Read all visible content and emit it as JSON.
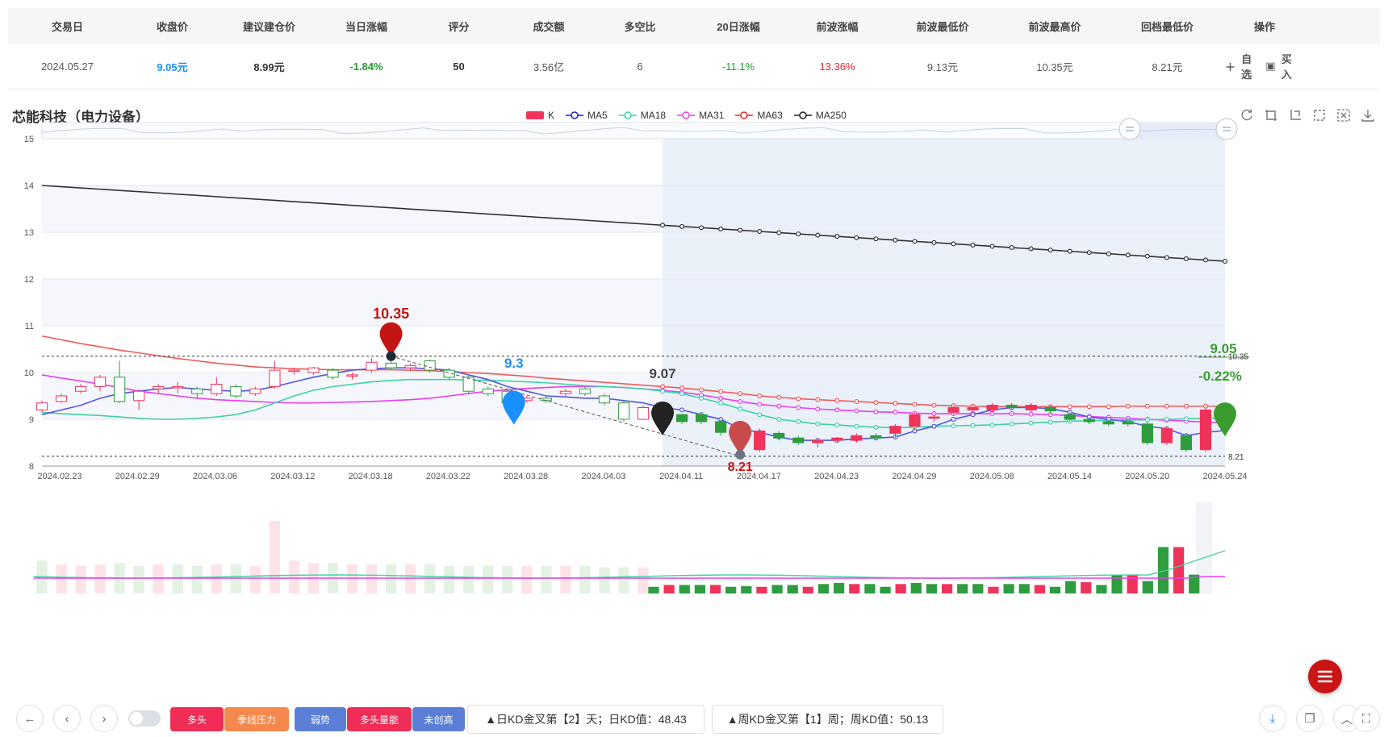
{
  "table": {
    "headers": [
      "交易日",
      "收盘价",
      "建议建仓价",
      "当日涨幅",
      "评分",
      "成交额",
      "多空比",
      "20日涨幅",
      "前波涨幅",
      "前波最低价",
      "前波最高价",
      "回档最低价",
      "操作"
    ],
    "row": [
      "2024.05.27",
      "9.05元",
      "8.99元",
      "-1.84%",
      "50",
      "3.56亿",
      "6",
      "-11.1%",
      "13.36%",
      "9.13元",
      "10.35元",
      "8.21元"
    ],
    "actions": {
      "watch": "自选",
      "buy": "买入"
    }
  },
  "chart_title": "芯能科技（电力设备）",
  "legend": [
    {
      "name": "K",
      "color": "#f0335a"
    },
    {
      "name": "MA5",
      "color": "#1f1fcf"
    },
    {
      "name": "MA18",
      "color": "#3fd1a4"
    },
    {
      "name": "MA31",
      "color": "#e83ff0"
    },
    {
      "name": "MA63",
      "color": "#e8262e"
    },
    {
      "name": "MA250",
      "color": "#222222"
    }
  ],
  "chart_data": {
    "type": "candlestick",
    "ylim": [
      8,
      15
    ],
    "y_ticks": [
      "8",
      "9",
      "10",
      "11",
      "12",
      "13",
      "14",
      "15"
    ],
    "x_tick_labels": [
      "2024.02.23",
      "2024.02.29",
      "2024.03.06",
      "2024.03.12",
      "2024.03.18",
      "2024.03.22",
      "2024.03.28",
      "2024.04.03",
      "2024.04.11",
      "2024.04.17",
      "2024.04.23",
      "2024.04.29",
      "2024.05.08",
      "2024.05.14",
      "2024.05.20",
      "2024.05.24"
    ],
    "candles": [
      [
        9.2,
        9.35,
        9.15,
        9.4
      ],
      [
        9.38,
        9.5,
        9.35,
        9.55
      ],
      [
        9.6,
        9.7,
        9.55,
        9.75
      ],
      [
        9.7,
        9.9,
        9.6,
        9.95
      ],
      [
        9.9,
        9.38,
        9.35,
        10.25
      ],
      [
        9.4,
        9.6,
        9.2,
        9.65
      ],
      [
        9.65,
        9.7,
        9.55,
        9.75
      ],
      [
        9.7,
        9.7,
        9.55,
        9.8
      ],
      [
        9.65,
        9.55,
        9.45,
        9.7
      ],
      [
        9.55,
        9.75,
        9.5,
        9.9
      ],
      [
        9.7,
        9.5,
        9.45,
        9.75
      ],
      [
        9.55,
        9.65,
        9.5,
        9.7
      ],
      [
        9.7,
        10.05,
        9.65,
        10.25
      ],
      [
        10.05,
        10.05,
        9.95,
        10.1
      ],
      [
        10.0,
        10.1,
        9.95,
        10.12
      ],
      [
        10.05,
        9.9,
        9.85,
        10.1
      ],
      [
        9.95,
        9.95,
        9.85,
        10.0
      ],
      [
        10.05,
        10.22,
        10.0,
        10.3
      ],
      [
        10.2,
        10.1,
        10.05,
        10.35
      ],
      [
        10.1,
        10.15,
        10.05,
        10.2
      ],
      [
        10.25,
        10.05,
        10.0,
        10.28
      ],
      [
        10.05,
        9.9,
        9.85,
        10.1
      ],
      [
        9.9,
        9.6,
        9.55,
        9.95
      ],
      [
        9.65,
        9.55,
        9.5,
        9.7
      ],
      [
        9.6,
        9.35,
        9.3,
        9.65
      ],
      [
        9.4,
        9.45,
        9.35,
        9.5
      ],
      [
        9.45,
        9.4,
        9.35,
        9.5
      ],
      [
        9.55,
        9.6,
        9.5,
        9.65
      ],
      [
        9.65,
        9.55,
        9.5,
        9.7
      ],
      [
        9.5,
        9.35,
        9.3,
        9.55
      ],
      [
        9.35,
        9.0,
        8.95,
        9.4
      ],
      [
        9.0,
        9.25,
        8.98,
        9.3
      ],
      [
        9.25,
        9.07,
        9.0,
        9.3
      ],
      [
        9.1,
        8.95,
        8.9,
        9.12
      ],
      [
        9.1,
        8.95,
        8.9,
        9.15
      ],
      [
        8.95,
        8.72,
        8.65,
        9.0
      ],
      [
        8.75,
        8.5,
        8.21,
        8.8
      ],
      [
        8.35,
        8.75,
        8.3,
        8.8
      ],
      [
        8.7,
        8.6,
        8.55,
        8.75
      ],
      [
        8.6,
        8.5,
        8.45,
        8.65
      ],
      [
        8.5,
        8.55,
        8.4,
        8.6
      ],
      [
        8.55,
        8.6,
        8.5,
        8.62
      ],
      [
        8.55,
        8.65,
        8.5,
        8.7
      ],
      [
        8.65,
        8.6,
        8.55,
        8.7
      ],
      [
        8.7,
        8.85,
        8.6,
        8.9
      ],
      [
        8.85,
        9.1,
        8.8,
        9.15
      ],
      [
        9.05,
        9.05,
        8.95,
        9.1
      ],
      [
        9.15,
        9.25,
        9.1,
        9.3
      ],
      [
        9.2,
        9.25,
        9.15,
        9.3
      ],
      [
        9.2,
        9.3,
        9.15,
        9.35
      ],
      [
        9.3,
        9.25,
        9.2,
        9.35
      ],
      [
        9.2,
        9.3,
        9.15,
        9.35
      ],
      [
        9.25,
        9.18,
        9.1,
        9.3
      ],
      [
        9.1,
        9.0,
        8.95,
        9.15
      ],
      [
        9.0,
        8.95,
        8.9,
        9.05
      ],
      [
        8.95,
        8.9,
        8.85,
        9.0
      ],
      [
        8.95,
        8.9,
        8.85,
        9.0
      ],
      [
        8.9,
        8.5,
        8.45,
        8.95
      ],
      [
        8.5,
        8.8,
        8.45,
        8.85
      ],
      [
        8.65,
        8.35,
        8.3,
        8.7
      ],
      [
        8.35,
        9.2,
        8.3,
        9.25
      ],
      [
        9.2,
        9.05,
        9.0,
        9.3
      ]
    ],
    "ma5": [
      9.1,
      9.2,
      9.3,
      9.45,
      9.55,
      9.6,
      9.65,
      9.68,
      9.65,
      9.62,
      9.6,
      9.62,
      9.7,
      9.8,
      9.9,
      9.98,
      10.05,
      10.08,
      10.1,
      10.1,
      10.08,
      10.05,
      9.95,
      9.85,
      9.7,
      9.6,
      9.5,
      9.48,
      9.45,
      9.45,
      9.4,
      9.35,
      9.25,
      9.2,
      9.1,
      9.0,
      8.8,
      8.72,
      8.62,
      8.55,
      8.55,
      8.55,
      8.58,
      8.6,
      8.62,
      8.75,
      8.85,
      9.0,
      9.1,
      9.2,
      9.25,
      9.25,
      9.23,
      9.15,
      9.05,
      9.0,
      8.95,
      8.85,
      8.8,
      8.65,
      8.72,
      8.76
    ],
    "ma18": [
      9.15,
      9.12,
      9.1,
      9.08,
      9.05,
      9.02,
      9.0,
      9.0,
      9.02,
      9.05,
      9.1,
      9.2,
      9.35,
      9.5,
      9.62,
      9.7,
      9.75,
      9.8,
      9.83,
      9.85,
      9.85,
      9.85,
      9.84,
      9.83,
      9.82,
      9.8,
      9.78,
      9.75,
      9.72,
      9.7,
      9.68,
      9.65,
      9.6,
      9.55,
      9.45,
      9.35,
      9.22,
      9.1,
      9.0,
      8.95,
      8.9,
      8.88,
      8.85,
      8.83,
      8.82,
      8.83,
      8.85,
      8.86,
      8.87,
      8.88,
      8.9,
      8.92,
      8.94,
      8.96,
      8.97,
      8.98,
      8.98,
      8.99,
      9.0,
      9.01,
      9.02,
      9.03
    ],
    "ma31": [
      9.95,
      9.88,
      9.82,
      9.75,
      9.68,
      9.6,
      9.55,
      9.5,
      9.45,
      9.42,
      9.4,
      9.38,
      9.36,
      9.35,
      9.35,
      9.36,
      9.37,
      9.38,
      9.4,
      9.42,
      9.45,
      9.5,
      9.55,
      9.6,
      9.63,
      9.66,
      9.68,
      9.7,
      9.7,
      9.7,
      9.68,
      9.65,
      9.62,
      9.58,
      9.52,
      9.45,
      9.38,
      9.32,
      9.28,
      9.25,
      9.22,
      9.2,
      9.18,
      9.16,
      9.15,
      9.13,
      9.12,
      9.12,
      9.12,
      9.12,
      9.12,
      9.11,
      9.1,
      9.08,
      9.06,
      9.04,
      9.02,
      9.0,
      8.98,
      8.96,
      8.94,
      8.92
    ],
    "ma63": [
      10.78,
      10.7,
      10.62,
      10.55,
      10.48,
      10.42,
      10.36,
      10.3,
      10.25,
      10.2,
      10.16,
      10.12,
      10.1,
      10.08,
      10.07,
      10.06,
      10.06,
      10.06,
      10.06,
      10.05,
      10.04,
      10.02,
      10.0,
      9.98,
      9.95,
      9.92,
      9.88,
      9.85,
      9.82,
      9.79,
      9.76,
      9.73,
      9.7,
      9.67,
      9.63,
      9.59,
      9.55,
      9.5,
      9.47,
      9.44,
      9.42,
      9.4,
      9.38,
      9.36,
      9.34,
      9.32,
      9.3,
      9.29,
      9.28,
      9.27,
      9.27,
      9.27,
      9.27,
      9.27,
      9.27,
      9.27,
      9.28,
      9.28,
      9.28,
      9.28,
      9.28,
      9.28
    ],
    "ma250_start": 14.0,
    "ma250_end": 12.38,
    "volume_up": [
      false,
      true,
      true,
      true,
      false,
      false,
      true,
      false,
      false,
      true,
      false,
      true,
      true,
      true,
      true,
      false,
      true,
      true,
      false,
      true,
      false,
      false,
      false,
      false,
      false,
      true,
      false,
      true,
      false,
      false,
      false,
      true,
      false,
      false,
      false,
      false,
      false,
      true,
      false,
      false,
      true,
      true,
      true,
      false,
      true,
      true,
      true,
      true,
      false,
      true,
      true,
      false,
      false,
      false,
      false,
      false,
      false,
      false,
      true,
      false,
      true,
      false
    ],
    "volume": [
      0.45,
      0.4,
      0.38,
      0.4,
      0.42,
      0.38,
      0.4,
      0.4,
      0.38,
      0.4,
      0.4,
      0.38,
      1.0,
      0.45,
      0.42,
      0.42,
      0.4,
      0.4,
      0.4,
      0.4,
      0.4,
      0.38,
      0.38,
      0.38,
      0.38,
      0.38,
      0.38,
      0.38,
      0.38,
      0.36,
      0.36,
      0.36,
      0.36,
      0.36,
      0.36,
      0.36,
      0.36,
      0.36,
      0.36,
      0.36,
      0.36,
      0.36,
      0.36,
      0.36,
      0.36,
      0.36,
      0.36,
      0.36,
      0.36,
      0.36,
      0.36,
      0.36,
      0.36,
      0.36,
      0.36,
      0.36,
      0.36,
      0.36,
      0.36,
      0.36,
      0.36,
      0.36
    ],
    "volume_bold": [
      0.29,
      0.37,
      0.37,
      0.37,
      0.37,
      0.29,
      0.32,
      0.29,
      0.37,
      0.37,
      0.29,
      0.41,
      0.46,
      0.41,
      0.41,
      0.29,
      0.41,
      0.46,
      0.41,
      0.41,
      0.41,
      0.41,
      0.29,
      0.41,
      0.41,
      0.37,
      0.29,
      0.54,
      0.49,
      0.37,
      0.82,
      0.82,
      0.54,
      2.02,
      2.02,
      0.82,
      1.37,
      4.0
    ],
    "annotations": {
      "high": "10.35",
      "low_mark": "8.21",
      "pin_blue": "9.3",
      "pin_black": "9.07",
      "last_price": "9.05",
      "last_change": "-0.22%",
      "line_high": "10.35",
      "line_low": "8.21"
    }
  },
  "bottom": {
    "tags": [
      {
        "label": "多头",
        "color": "#ef2d56"
      },
      {
        "label": "季线压力",
        "color": "#f5894d"
      },
      {
        "label": "弱势",
        "color": "#5b7fd6"
      },
      {
        "label": "多头量能",
        "color": "#ef2d56"
      },
      {
        "label": "未创高",
        "color": "#5b7fd6"
      }
    ],
    "kd_day": "▲日KD金叉第【2】天；日KD值：48.43",
    "kd_week": "▲周KD金叉第【1】周；周KD值：50.13"
  }
}
